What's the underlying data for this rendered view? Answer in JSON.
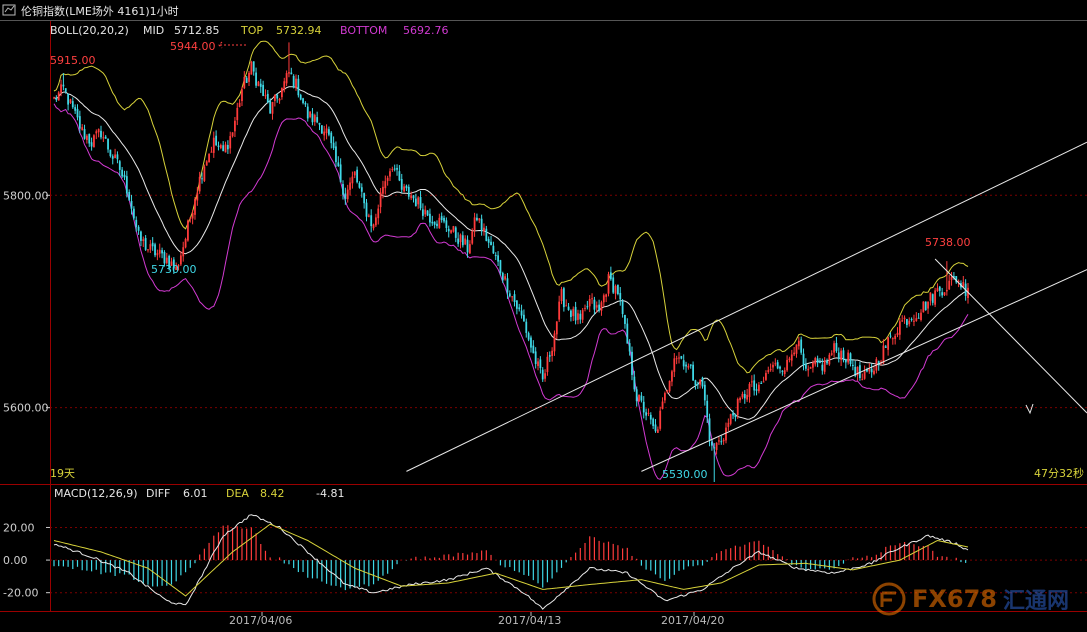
{
  "window": {
    "title": "伦铜指数(LME场外 4161)1小时",
    "title_icon": "chart-window-icon"
  },
  "main_panel": {
    "boll_header": {
      "name": "BOLL(20,20,2)",
      "mid_label": "MID",
      "mid_value": "5712.85",
      "top_label": "TOP",
      "top_value": "5732.94",
      "bottom_label": "BOTTOM",
      "bottom_value": "5692.76"
    },
    "bottom_left_label": "19天",
    "countdown": "47分32秒",
    "colors": {
      "up": "#ff3b3b",
      "down": "#3fd8e6",
      "mid": "#e8e8e8",
      "top": "#d7d23a",
      "bottom": "#d23ad2",
      "trend": "#e8e8e8",
      "grid": "#7a0000"
    }
  },
  "macd_panel": {
    "header": {
      "name": "MACD(12,26,9)",
      "diff_label": "DIFF",
      "diff_value": "6.01",
      "dea_label": "DEA",
      "dea_value": "8.42",
      "macd_value": "-4.81"
    }
  },
  "x_axis_dates": [
    "2017/04/06",
    "2017/04/13",
    "2017/04/20"
  ],
  "watermark": {
    "brand": "FX678",
    "cn": "汇通网"
  },
  "chart_data": [
    {
      "type": "candlestick",
      "title": "伦铜指数(LME场外 4161)1小时",
      "ylim": [
        5530,
        5950
      ],
      "yticks": [
        5600,
        5800
      ],
      "ytick_labels": [
        "5600.00",
        "5800.00"
      ],
      "annotations": [
        {
          "label": "5944.00",
          "x": "2017/04/05",
          "y": 5944.0
        },
        {
          "label": "5915.00",
          "x": "2017/04/03",
          "y": 5915.0
        },
        {
          "label": "5730.00",
          "x": "2017/04/04",
          "y": 5730.0
        },
        {
          "label": "5530.00",
          "x": "2017/04/19",
          "y": 5530.0
        },
        {
          "label": "5738.00",
          "x": "2017/04/26",
          "y": 5738.0
        }
      ],
      "close_anchors": [
        [
          0,
          5890
        ],
        [
          4,
          5900
        ],
        [
          8,
          5880
        ],
        [
          12,
          5860
        ],
        [
          16,
          5850
        ],
        [
          20,
          5860
        ],
        [
          24,
          5840
        ],
        [
          28,
          5825
        ],
        [
          32,
          5800
        ],
        [
          36,
          5760
        ],
        [
          40,
          5750
        ],
        [
          44,
          5745
        ],
        [
          48,
          5740
        ],
        [
          52,
          5730
        ],
        [
          56,
          5760
        ],
        [
          60,
          5800
        ],
        [
          64,
          5830
        ],
        [
          68,
          5850
        ],
        [
          72,
          5840
        ],
        [
          76,
          5860
        ],
        [
          80,
          5900
        ],
        [
          84,
          5920
        ],
        [
          88,
          5900
        ],
        [
          92,
          5880
        ],
        [
          96,
          5895
        ],
        [
          100,
          5915
        ],
        [
          104,
          5900
        ],
        [
          108,
          5875
        ],
        [
          112,
          5870
        ],
        [
          116,
          5860
        ],
        [
          120,
          5830
        ],
        [
          124,
          5800
        ],
        [
          128,
          5820
        ],
        [
          132,
          5790
        ],
        [
          136,
          5770
        ],
        [
          140,
          5810
        ],
        [
          144,
          5830
        ],
        [
          148,
          5805
        ],
        [
          152,
          5800
        ],
        [
          156,
          5790
        ],
        [
          160,
          5780
        ],
        [
          164,
          5775
        ],
        [
          168,
          5770
        ],
        [
          172,
          5760
        ],
        [
          176,
          5750
        ],
        [
          180,
          5780
        ],
        [
          184,
          5760
        ],
        [
          188,
          5740
        ],
        [
          192,
          5720
        ],
        [
          196,
          5700
        ],
        [
          200,
          5680
        ],
        [
          204,
          5650
        ],
        [
          208,
          5625
        ],
        [
          212,
          5660
        ],
        [
          216,
          5705
        ],
        [
          220,
          5690
        ],
        [
          224,
          5680
        ],
        [
          228,
          5700
        ],
        [
          232,
          5690
        ],
        [
          236,
          5720
        ],
        [
          240,
          5710
        ],
        [
          244,
          5660
        ],
        [
          248,
          5610
        ],
        [
          252,
          5595
        ],
        [
          256,
          5575
        ],
        [
          260,
          5610
        ],
        [
          264,
          5650
        ],
        [
          268,
          5645
        ],
        [
          272,
          5630
        ],
        [
          276,
          5620
        ],
        [
          280,
          5560
        ],
        [
          284,
          5570
        ],
        [
          288,
          5590
        ],
        [
          292,
          5605
        ],
        [
          296,
          5620
        ],
        [
          300,
          5615
        ],
        [
          304,
          5635
        ],
        [
          308,
          5640
        ],
        [
          312,
          5640
        ],
        [
          316,
          5665
        ],
        [
          320,
          5630
        ],
        [
          324,
          5640
        ],
        [
          328,
          5640
        ],
        [
          332,
          5655
        ],
        [
          336,
          5650
        ],
        [
          340,
          5640
        ],
        [
          344,
          5625
        ],
        [
          348,
          5635
        ],
        [
          352,
          5650
        ],
        [
          356,
          5665
        ],
        [
          360,
          5680
        ],
        [
          364,
          5685
        ],
        [
          368,
          5690
        ],
        [
          372,
          5700
        ],
        [
          376,
          5710
        ],
        [
          380,
          5715
        ],
        [
          384,
          5722
        ],
        [
          388,
          5712
        ]
      ],
      "ranges": [
        {
          "from": 0,
          "to": 60,
          "low": 5730,
          "high": 5920
        },
        {
          "from": 200,
          "to": 260,
          "low": 5570,
          "high": 5720
        },
        {
          "from": 270,
          "to": 300,
          "low": 5530,
          "high": 5660
        },
        {
          "from": 360,
          "to": 389,
          "low": 5680,
          "high": 5740
        }
      ],
      "boll": {
        "mid_last": 5712.85,
        "top_last": 5732.94,
        "bottom_last": 5692.76
      },
      "trendlines": [
        {
          "name": "upper-channel",
          "p1": [
            150,
            5540
          ],
          "p2": [
            389,
            5850
          ]
        },
        {
          "name": "lower-channel",
          "p1": [
            250,
            5540
          ],
          "p2": [
            389,
            5730
          ]
        },
        {
          "name": "projection-arrow",
          "p1": [
            375,
            5740
          ],
          "p2": [
            389,
            5595
          ]
        }
      ]
    },
    {
      "type": "bar",
      "title": "MACD(12,26,9)",
      "ylim": [
        -30,
        35
      ],
      "yticks": [
        -20,
        0,
        20
      ],
      "ytick_labels": [
        "-20.00",
        "0.00",
        "20.00"
      ],
      "series": [
        {
          "name": "DIFF",
          "last": 6.01
        },
        {
          "name": "DEA",
          "last": 8.42
        },
        {
          "name": "MACD",
          "last": -4.81
        }
      ],
      "diff_anchors": [
        [
          0,
          10
        ],
        [
          16,
          2
        ],
        [
          32,
          -8
        ],
        [
          48,
          -25
        ],
        [
          56,
          -28
        ],
        [
          72,
          15
        ],
        [
          84,
          28
        ],
        [
          96,
          20
        ],
        [
          108,
          5
        ],
        [
          124,
          -15
        ],
        [
          136,
          -20
        ],
        [
          152,
          -15
        ],
        [
          168,
          -12
        ],
        [
          184,
          -5
        ],
        [
          200,
          -20
        ],
        [
          208,
          -30
        ],
        [
          228,
          -5
        ],
        [
          244,
          -8
        ],
        [
          260,
          -25
        ],
        [
          276,
          -18
        ],
        [
          292,
          -2
        ],
        [
          300,
          5
        ],
        [
          316,
          -5
        ],
        [
          332,
          -8
        ],
        [
          348,
          -2
        ],
        [
          356,
          5
        ],
        [
          372,
          15
        ],
        [
          384,
          10
        ],
        [
          389,
          6
        ]
      ],
      "dea_anchors": [
        [
          0,
          12
        ],
        [
          20,
          5
        ],
        [
          40,
          -5
        ],
        [
          56,
          -22
        ],
        [
          76,
          5
        ],
        [
          92,
          22
        ],
        [
          108,
          12
        ],
        [
          128,
          -5
        ],
        [
          148,
          -16
        ],
        [
          168,
          -14
        ],
        [
          188,
          -8
        ],
        [
          208,
          -18
        ],
        [
          228,
          -15
        ],
        [
          250,
          -12
        ],
        [
          268,
          -18
        ],
        [
          284,
          -14
        ],
        [
          300,
          -3
        ],
        [
          320,
          -2
        ],
        [
          340,
          -6
        ],
        [
          360,
          0
        ],
        [
          376,
          12
        ],
        [
          389,
          8
        ]
      ]
    }
  ]
}
